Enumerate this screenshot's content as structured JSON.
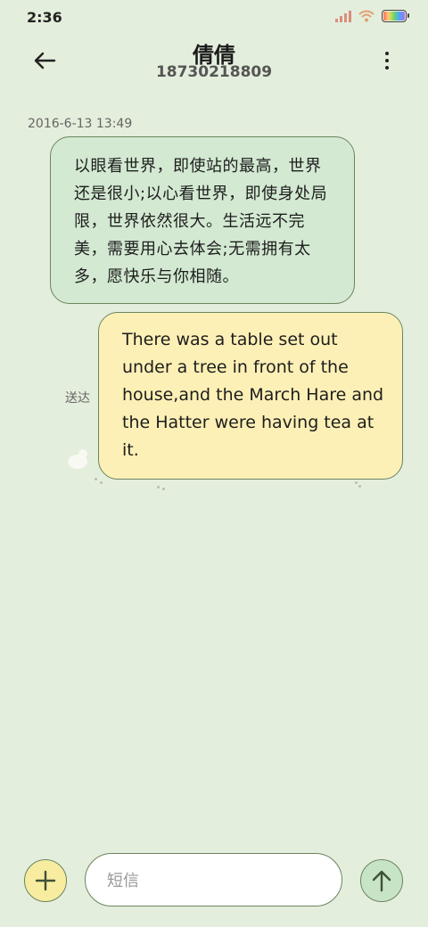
{
  "status_bar": {
    "time": "2:36",
    "icons": [
      "signal-icon",
      "wifi-icon",
      "battery-icon"
    ]
  },
  "header": {
    "back_icon": "arrow-left-icon",
    "contact_name": "倩倩",
    "contact_number": "18730218809",
    "more_icon": "more-vertical-icon"
  },
  "conversation": {
    "timestamp": "2016-6-13 13:49",
    "messages": [
      {
        "direction": "received",
        "text": "以眼看世界，即使站的最高，世界还是很小;以心看世界，即使身处局限，世界依然很大。生活远不完美，需要用心去体会;无需拥有太多，愿快乐与你相随。"
      },
      {
        "direction": "sent",
        "text": "There was a table set out under a tree in front of the house,and the March Hare and the Hatter were having tea at it.",
        "status": "送达"
      }
    ]
  },
  "input_bar": {
    "add_icon": "plus-icon",
    "placeholder": "短信",
    "send_icon": "arrow-up-icon"
  },
  "colors": {
    "background": "#e4eedc",
    "received_bubble": "#d3e9d2",
    "sent_bubble": "#fdf0b6",
    "border": "#6a8560",
    "add_button": "#f7ec9f",
    "send_button": "#c8e4c6"
  }
}
